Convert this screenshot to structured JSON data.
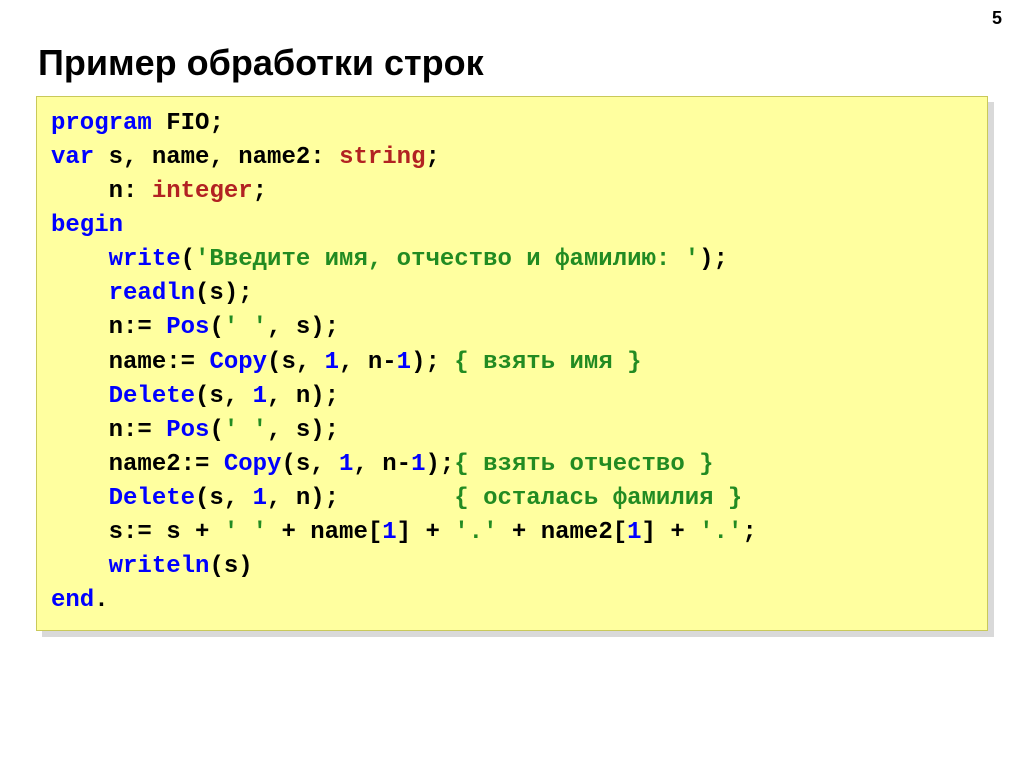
{
  "page_number": "5",
  "heading": "Пример обработки строк",
  "code": {
    "l1": {
      "kw_program": "program",
      "sp1": " ",
      "id_fio": "FIO",
      "semi": ";"
    },
    "l2": {
      "kw_var": "var",
      "sp1": " ",
      "ids": "s, name, name2: ",
      "typ": "string",
      "semi": ";"
    },
    "l3": {
      "indent": "    ",
      "ids": "n: ",
      "typ": "integer",
      "semi": ";"
    },
    "l4": {
      "kw_begin": "begin"
    },
    "l5": {
      "indent": "    ",
      "fn": "write",
      "open": "(",
      "str": "'Введите имя, отчество и фамилию: '",
      "close": ");"
    },
    "l6": {
      "indent": "    ",
      "fn": "readln",
      "args": "(s);"
    },
    "l7": {
      "indent": "    ",
      "lhs": "n:= ",
      "fn": "Pos",
      "open": "(",
      "str": "' '",
      "rest": ", s);"
    },
    "l8": {
      "indent": "    ",
      "lhs": "name:= ",
      "fn": "Copy",
      "open": "(s, ",
      "num1": "1",
      "mid": ", n-",
      "num2": "1",
      "close": "); ",
      "cmt": "{ взять имя }"
    },
    "l9": {
      "indent": "    ",
      "fn": "Delete",
      "open": "(s, ",
      "num": "1",
      "rest": ", n);"
    },
    "l10": {
      "indent": "    ",
      "lhs": "n:= ",
      "fn": "Pos",
      "open": "(",
      "str": "' '",
      "rest": ", s);"
    },
    "l11": {
      "indent": "    ",
      "lhs": "name2:= ",
      "fn": "Copy",
      "open": "(s, ",
      "num1": "1",
      "mid": ", n-",
      "num2": "1",
      "close": ");",
      "cmt": "{ взять отчество }"
    },
    "l12": {
      "indent": "    ",
      "fn": "Delete",
      "open": "(s, ",
      "num": "1",
      "rest": ", n);",
      "pad": "        ",
      "cmt": "{ осталась фамилия }"
    },
    "l13": {
      "indent": "    ",
      "lhs": "s:= s + ",
      "s1": "' '",
      "p1": " + name[",
      "n1": "1",
      "p2": "] + ",
      "s2": "'.'",
      "p3": " + name2[",
      "n2": "1",
      "p4": "] + ",
      "s3": "'.'",
      "semi": ";"
    },
    "l14": {
      "indent": "    ",
      "fn": "writeln",
      "args": "(s)"
    },
    "l15": {
      "kw_end": "end",
      "dot": "."
    }
  }
}
